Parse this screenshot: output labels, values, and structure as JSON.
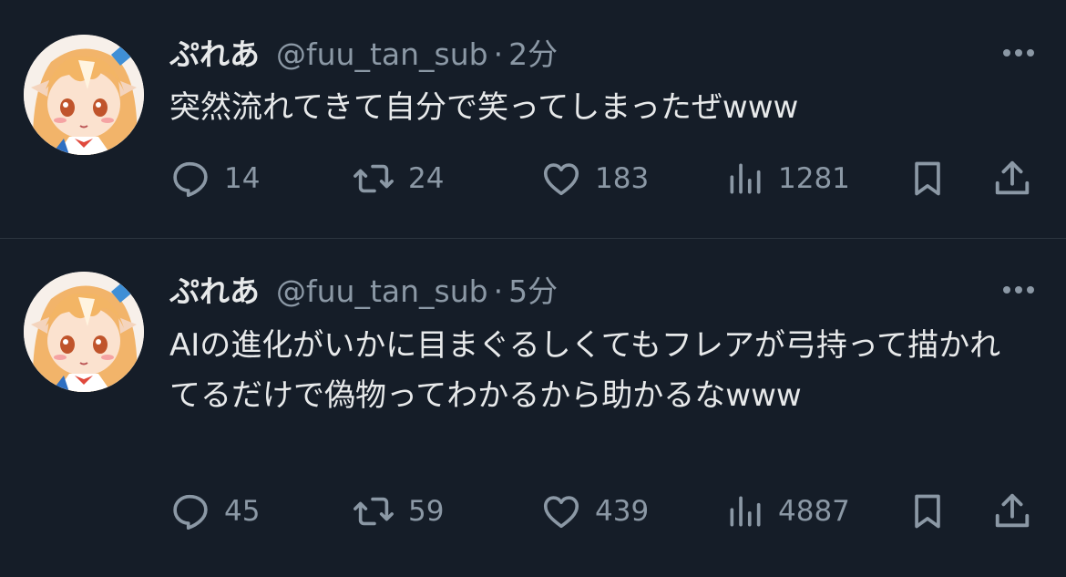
{
  "colors": {
    "background": "#151d28",
    "text_primary": "#e7e9ea",
    "text_secondary": "#8b98a5",
    "divider": "#2d3640"
  },
  "icons": {
    "reply": "speech-bubble",
    "retweet": "two-arrows-loop",
    "like": "heart",
    "views": "bar-chart",
    "bookmark": "bookmark",
    "share": "upload-arrow",
    "more": "three-dots"
  },
  "tweets": [
    {
      "display_name": "ぷれあ",
      "handle": "@fuu_tan_sub",
      "separator": "·",
      "time": "2分",
      "text": "突然流れてきて自分で笑ってしまったぜwww",
      "replies": "14",
      "retweets": "24",
      "likes": "183",
      "views": "1281"
    },
    {
      "display_name": "ぷれあ",
      "handle": "@fuu_tan_sub",
      "separator": "·",
      "time": "5分",
      "text": "AIの進化がいかに目まぐるしくてもフレアが弓持って描かれてるだけで偽物ってわかるから助かるなwww",
      "replies": "45",
      "retweets": "59",
      "likes": "439",
      "views": "4887"
    }
  ]
}
